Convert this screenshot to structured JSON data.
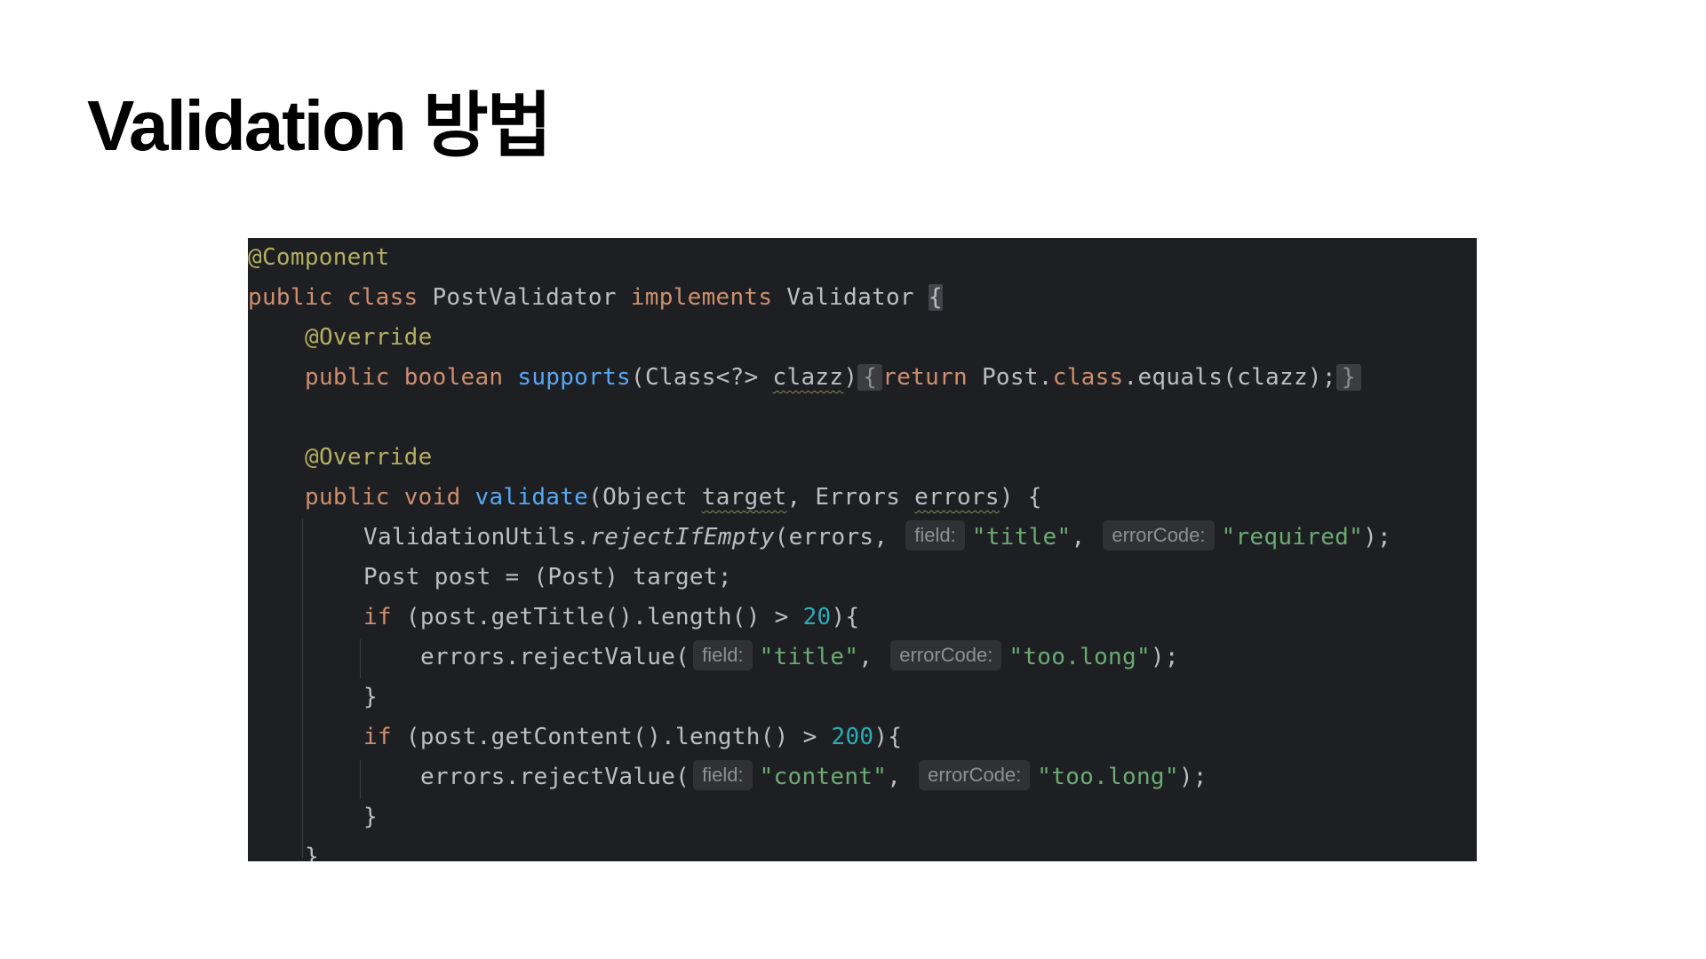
{
  "slide": {
    "title": "Validation 방법"
  },
  "code": {
    "l1": {
      "annotation": "@Component"
    },
    "l2": {
      "kw_public": "public",
      "kw_class": "class",
      "class_name": " PostValidator ",
      "kw_implements": "implements",
      "interface_name": " Validator ",
      "brace": "{"
    },
    "l3": {
      "annotation": "@Override"
    },
    "l4": {
      "kw_public": "public",
      "kw_boolean": "boolean",
      "method": "supports",
      "params": "(Class<?> ",
      "param_name": "clazz",
      "close_paren": ")",
      "fold_open": "{",
      "kw_return": "return",
      "expr_a": " Post.",
      "kw_class": "class",
      "expr_b": ".equals(clazz);",
      "fold_close": "}"
    },
    "l6": {
      "annotation": "@Override"
    },
    "l7": {
      "kw_public": "public",
      "kw_void": "void",
      "method": "validate",
      "params_a": "(Object ",
      "param_target": "target",
      "params_b": ", Errors ",
      "param_errors": "errors",
      "params_c": ") {"
    },
    "l8": {
      "prefix": "ValidationUtils.",
      "method": "rejectIfEmpty",
      "args_a": "(errors, ",
      "hint_field": "field:",
      "str_title": "\"title\"",
      "comma": ", ",
      "hint_error_code": "errorCode:",
      "str_required": "\"required\"",
      "end": ");"
    },
    "l9": {
      "text": "Post post = (Post) target;"
    },
    "l10": {
      "kw_if": "if",
      "cond": " (post.getTitle().length() > ",
      "num": "20",
      "end": "){"
    },
    "l11": {
      "call": "errors.rejectValue(",
      "hint_field": "field:",
      "str_title": "\"title\"",
      "comma": ", ",
      "hint_error_code": "errorCode:",
      "str_code": "\"too.long\"",
      "end": ");"
    },
    "l12": {
      "text": "}"
    },
    "l13": {
      "kw_if": "if",
      "cond": " (post.getContent().length() > ",
      "num": "200",
      "end": "){"
    },
    "l14": {
      "call": "errors.rejectValue(",
      "hint_field": "field:",
      "str_content": "\"content\"",
      "comma": ", ",
      "hint_error_code": "errorCode:",
      "str_code": "\"too.long\"",
      "end": ");"
    },
    "l15": {
      "text": "}"
    },
    "l16": {
      "text": "}"
    }
  }
}
